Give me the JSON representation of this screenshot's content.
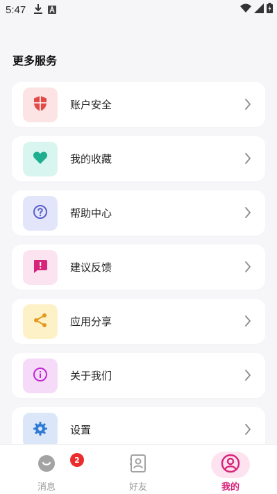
{
  "status_bar": {
    "time": "5:47",
    "left_icons": [
      "download-icon",
      "a-notification-icon"
    ],
    "right_icons": [
      "wifi-icon",
      "signal-icon",
      "battery-icon"
    ]
  },
  "section": {
    "title": "更多服务"
  },
  "menu": [
    {
      "label": "账户安全",
      "icon": "shield-icon",
      "icon_bg": "#fde4e4",
      "icon_color": "#e24a4a"
    },
    {
      "label": "我的收藏",
      "icon": "heart-icon",
      "icon_bg": "#d8f6ef",
      "icon_color": "#1fae8e"
    },
    {
      "label": "帮助中心",
      "icon": "help-circle-icon",
      "icon_bg": "#e3e6fb",
      "icon_color": "#5a5fcc"
    },
    {
      "label": "建议反馈",
      "icon": "feedback-icon",
      "icon_bg": "#fbe3ef",
      "icon_color": "#d6247a"
    },
    {
      "label": "应用分享",
      "icon": "share-icon",
      "icon_bg": "#fdf1c8",
      "icon_color": "#e49a1f"
    },
    {
      "label": "关于我们",
      "icon": "info-icon",
      "icon_bg": "#f6dbf8",
      "icon_color": "#c026d3"
    },
    {
      "label": "设置",
      "icon": "gear-icon",
      "icon_bg": "#dbe7f9",
      "icon_color": "#2f7bd6"
    }
  ],
  "bottom_nav": {
    "items": [
      {
        "label": "消息",
        "icon": "chat-bubble-icon",
        "badge": "2",
        "active": false
      },
      {
        "label": "好友",
        "icon": "contacts-icon",
        "active": false
      },
      {
        "label": "我的",
        "icon": "profile-icon",
        "active": true
      }
    ],
    "active_color": "#d6247a",
    "inactive_color": "#9a9a9a"
  }
}
